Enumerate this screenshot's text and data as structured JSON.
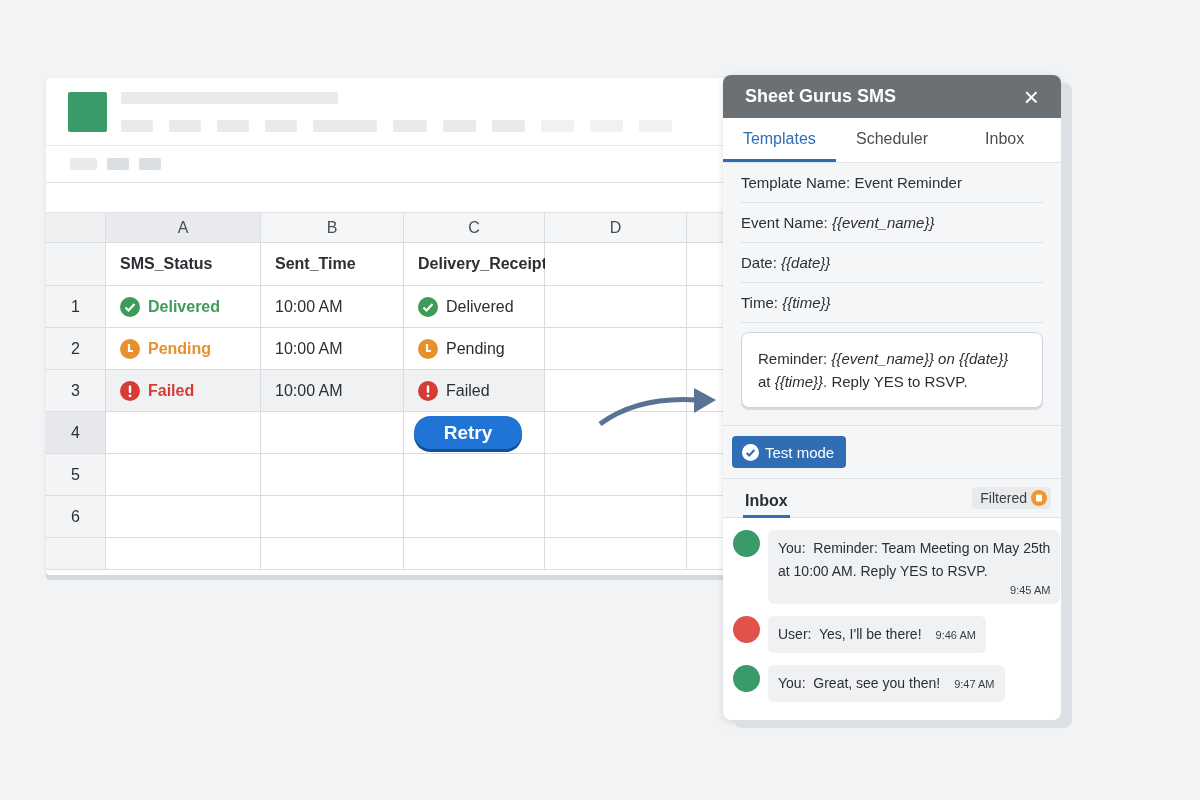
{
  "spreadsheet": {
    "columns": [
      {
        "label": "A",
        "selected": true
      },
      {
        "label": "B",
        "selected": false
      },
      {
        "label": "C",
        "selected": false
      },
      {
        "label": "D",
        "selected": false
      }
    ],
    "header_row": [
      "SMS_Status",
      "Sent_Time",
      "Delivery_Receipt"
    ],
    "rows": [
      {
        "number": "1",
        "highlighted": false,
        "sms_status": {
          "kind": "delivered",
          "text": "Delivered"
        },
        "sent_time": "10:00 AM",
        "delivery_receipt": {
          "kind": "delivered",
          "text": "Delivered"
        }
      },
      {
        "number": "2",
        "highlighted": false,
        "sms_status": {
          "kind": "pending",
          "text": "Pending"
        },
        "sent_time": "10:00 AM",
        "delivery_receipt": {
          "kind": "pending",
          "text": "Pending"
        }
      },
      {
        "number": "3",
        "highlighted": true,
        "sms_status": {
          "kind": "failed",
          "text": "Failed"
        },
        "sent_time": "10:00 AM",
        "delivery_receipt": {
          "kind": "failed",
          "text": "Failed"
        }
      },
      {
        "number": "4",
        "selected": true,
        "retry_button": "Retry"
      },
      {
        "number": "5",
        "selected": false
      },
      {
        "number": "6",
        "selected": false
      }
    ]
  },
  "panel": {
    "title": "Sheet Gurus SMS",
    "close": "×",
    "tabs": [
      {
        "label": "Templates",
        "selected": true
      },
      {
        "label": "Scheduler",
        "selected": false
      },
      {
        "label": "Inbox",
        "selected": false
      }
    ],
    "fields": [
      "Template Name: Event Reminder",
      "Event Name: *{{event_name}}*",
      "Date: *{{date}}*",
      "Time: *{{time}}*"
    ],
    "message_template": [
      "Reminder: *{{event_name}} on {{date}}*",
      "at *{{time}}*. Reply YES to RSVP."
    ],
    "test_mode": {
      "label": "Test mode",
      "checked": true
    },
    "inbox": {
      "title": "Inbox",
      "filter": "Filtered",
      "messages": [
        {
          "sender": "You:",
          "lines": [
            "Reminder: Team Meeting on May 25th",
            "at 10:00 AM. Reply YES to RSVP."
          ],
          "time": "9:45 AM",
          "color": "#3a9a6a"
        },
        {
          "sender": "User:",
          "lines": [
            "Yes, I'll be there!"
          ],
          "time": "9:46 AM",
          "color": "#e0524a"
        },
        {
          "sender": "You:",
          "lines": [
            "Great, see you then!"
          ],
          "time": "9:47 AM",
          "color": "#3a9a6a"
        }
      ]
    }
  }
}
